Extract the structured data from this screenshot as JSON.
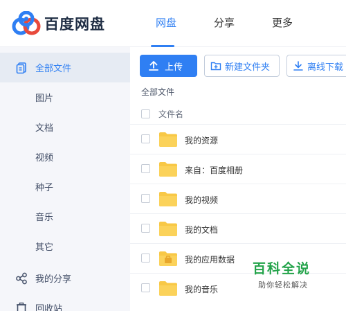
{
  "app": {
    "name": "百度网盘"
  },
  "nav": {
    "tabs": [
      {
        "label": "网盘",
        "active": true
      },
      {
        "label": "分享",
        "active": false
      },
      {
        "label": "更多",
        "active": false
      }
    ]
  },
  "sidebar": {
    "items": [
      {
        "label": "全部文件",
        "icon": "file-icon",
        "active": true
      },
      {
        "label": "图片",
        "icon": "",
        "active": false
      },
      {
        "label": "文档",
        "icon": "",
        "active": false
      },
      {
        "label": "视频",
        "icon": "",
        "active": false
      },
      {
        "label": "种子",
        "icon": "",
        "active": false
      },
      {
        "label": "音乐",
        "icon": "",
        "active": false
      },
      {
        "label": "其它",
        "icon": "",
        "active": false
      },
      {
        "label": "我的分享",
        "icon": "share-icon",
        "active": false
      },
      {
        "label": "回收站",
        "icon": "recycle-bin-icon",
        "active": false
      }
    ]
  },
  "toolbar": {
    "upload_label": "上传",
    "new_folder_label": "新建文件夹",
    "offline_download_label": "离线下载"
  },
  "breadcrumb": "全部文件",
  "file_list": {
    "column_header": "文件名",
    "rows": [
      {
        "name": "我的资源",
        "icon": "folder-icon"
      },
      {
        "name": "来自：百度相册",
        "icon": "folder-icon"
      },
      {
        "name": "我的视频",
        "icon": "folder-icon"
      },
      {
        "name": "我的文档",
        "icon": "folder-icon"
      },
      {
        "name": "我的应用数据",
        "icon": "app-data-folder-icon"
      },
      {
        "name": "我的音乐",
        "icon": "folder-icon"
      }
    ]
  },
  "watermark": {
    "title": "百科全说",
    "subtitle": "助你轻松解决"
  },
  "colors": {
    "accent": "#2f7ff3",
    "folder": "#f8c846",
    "sidebar_bg": "#f5f6fa",
    "watermark_green": "#23a34a"
  }
}
